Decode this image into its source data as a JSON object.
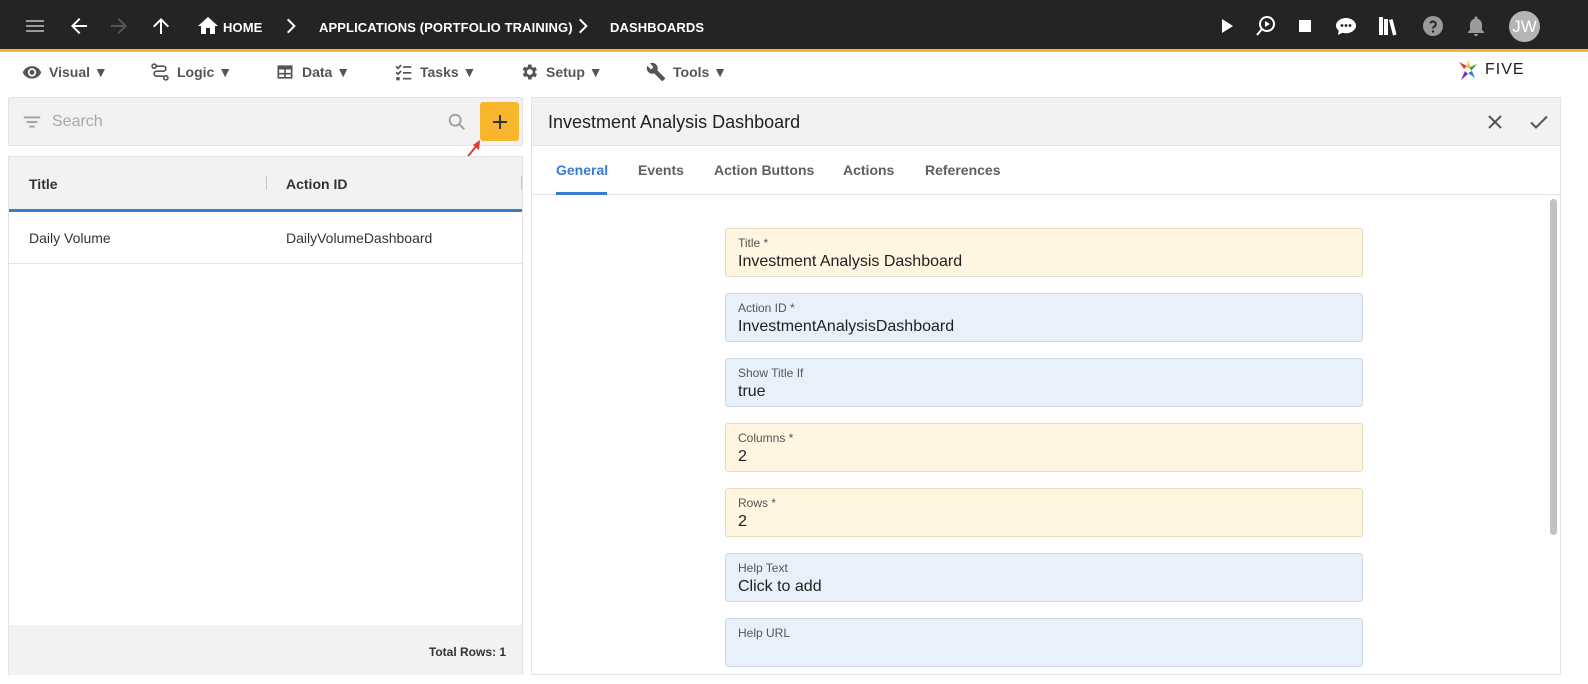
{
  "topbar": {
    "breadcrumbs": [
      "HOME",
      "APPLICATIONS (PORTFOLIO TRAINING)",
      "DASHBOARDS"
    ],
    "avatar_initials": "JW",
    "accent_color": "#f6b531",
    "icons": [
      "menu-icon",
      "back-arrow-icon",
      "forward-arrow-icon",
      "up-arrow-icon",
      "home-icon",
      "play-icon",
      "inspect-icon",
      "stop-icon",
      "chat-icon",
      "library-icon",
      "help-icon",
      "bell-icon"
    ]
  },
  "menubar": {
    "items": [
      {
        "label": "Visual ▼",
        "icon": "eye-icon"
      },
      {
        "label": "Logic ▼",
        "icon": "logic-icon"
      },
      {
        "label": "Data ▼",
        "icon": "table-icon"
      },
      {
        "label": "Tasks ▼",
        "icon": "tasks-icon"
      },
      {
        "label": "Setup ▼",
        "icon": "gear-icon"
      },
      {
        "label": "Tools ▼",
        "icon": "tools-icon"
      }
    ],
    "logo_text": "FIVE"
  },
  "list": {
    "search_placeholder": "Search",
    "add_button": "+",
    "columns": [
      "Title",
      "Action ID"
    ],
    "rows": [
      {
        "title": "Daily Volume",
        "action_id": "DailyVolumeDashboard"
      }
    ],
    "total": "Total Rows: 1"
  },
  "form": {
    "title": "Investment Analysis Dashboard",
    "tabs": [
      "General",
      "Events",
      "Action Buttons",
      "Actions",
      "References"
    ],
    "active_tab": "General",
    "fields": [
      {
        "label": "Title *",
        "value": "Investment Analysis Dashboard",
        "required": true
      },
      {
        "label": "Action ID *",
        "value": "InvestmentAnalysisDashboard",
        "required": false
      },
      {
        "label": "Show Title If",
        "value": "true",
        "required": false
      },
      {
        "label": "Columns *",
        "value": "2",
        "required": true
      },
      {
        "label": "Rows *",
        "value": "2",
        "required": true
      },
      {
        "label": "Help Text",
        "value": "Click to add",
        "required": false
      },
      {
        "label": "Help URL",
        "value": "",
        "required": false
      }
    ]
  }
}
